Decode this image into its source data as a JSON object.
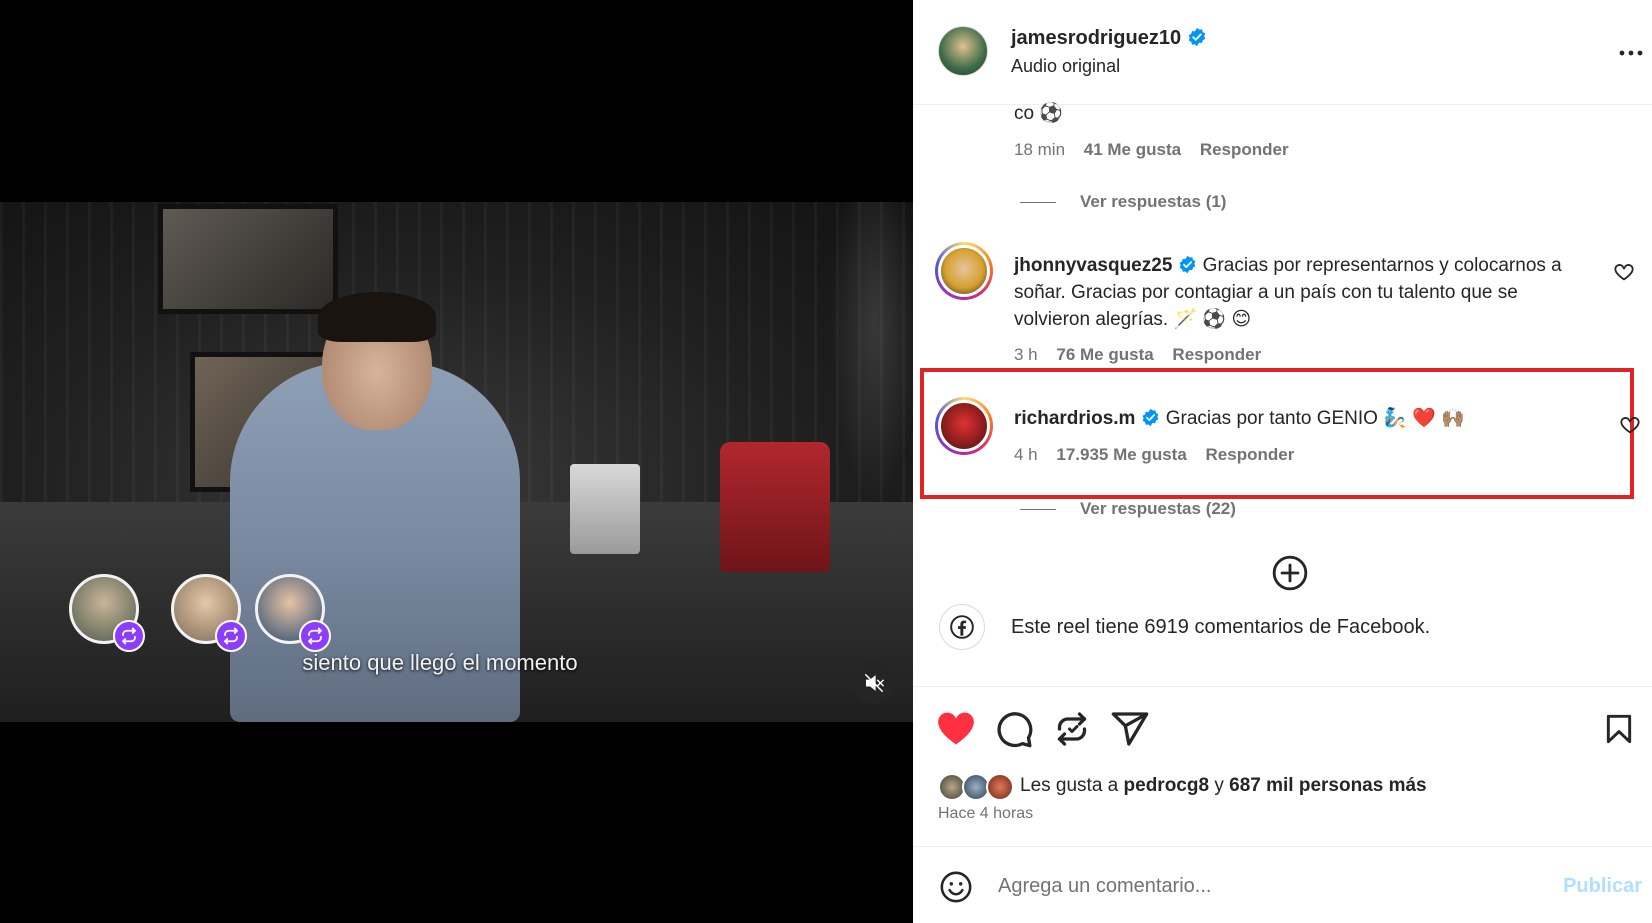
{
  "video": {
    "subtitle": "siento que llegó el momento",
    "mute_icon": "speaker-muted-icon",
    "reposters": [
      "avatar",
      "avatar",
      "avatar"
    ]
  },
  "header": {
    "username": "jamesrodriguez10",
    "audio": "Audio original",
    "more_icon": "more-horizontal-icon"
  },
  "comments": {
    "truncated": {
      "text_tail": "co ⚽",
      "time": "18 min",
      "likes": "41 Me gusta",
      "reply": "Responder",
      "view_replies": "Ver respuestas (1)"
    },
    "items": [
      {
        "username": "jhonnyvasquez25",
        "line1": "Gracias por representarnos y colocarnos a",
        "line2": "soñar. Gracias por contagiar a un país con tu talento que se",
        "line3": "volvieron alegrías. 🪄 ⚽ 😊",
        "time": "3 h",
        "likes": "76 Me gusta",
        "reply": "Responder"
      },
      {
        "username": "richardrios.m",
        "text": "Gracias por tanto GENIO 🧞 ❤️ 🙌🏽",
        "time": "4 h",
        "likes": "17.935 Me gusta",
        "reply": "Responder",
        "view_replies": "Ver respuestas (22)"
      }
    ],
    "facebook_note": "Este reel tiene 6919 comentarios de Facebook."
  },
  "actions": {
    "liked": true,
    "like_color": "#ff3040",
    "likes_prefix": "Les gusta a",
    "likes_user": "pedrocg8",
    "likes_and": "y",
    "likes_rest": "687 mil personas más",
    "time_ago": "Hace 4 horas"
  },
  "composer": {
    "placeholder": "Agrega un comentario...",
    "publish": "Publicar"
  },
  "colors": {
    "verified": "#0095f6",
    "highlight": "#e02424",
    "publish_disabled": "#b2dffc",
    "repost_badge": "#8c3dff"
  }
}
